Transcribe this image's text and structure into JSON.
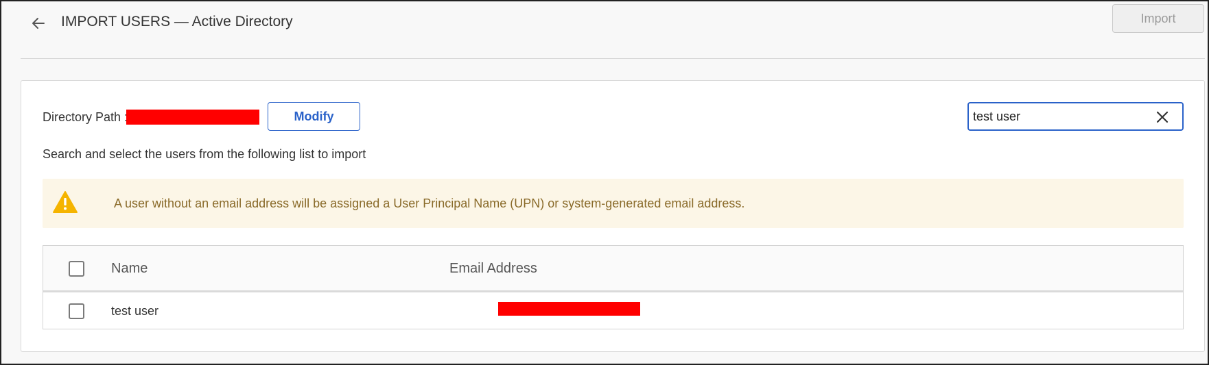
{
  "header": {
    "title": "IMPORT USERS — Active Directory",
    "import_label": "Import"
  },
  "directory": {
    "path_label": "Directory Path :",
    "modify_label": "Modify"
  },
  "search": {
    "value": "test user"
  },
  "instruction": "Search and select the users from the following list to import",
  "warning": {
    "text": "A user without an email address will be assigned a User Principal Name (UPN) or system-generated email address.",
    "icon": "warning-triangle-icon",
    "color": "#f5b400"
  },
  "table": {
    "columns": [
      "Name",
      "Email Address"
    ],
    "rows": [
      {
        "name": "test user",
        "email_visible_fragment": "@"
      }
    ]
  },
  "colors": {
    "accent": "#2a62c9",
    "redaction": "#ff0000"
  }
}
